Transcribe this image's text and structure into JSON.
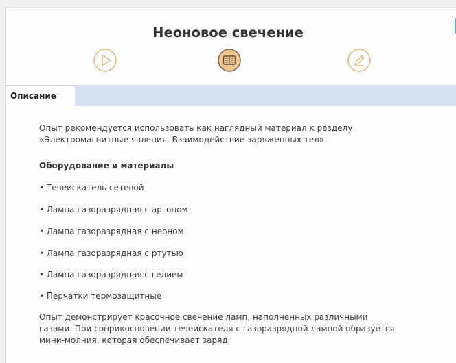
{
  "page": {
    "title": "Неоновое свечение",
    "modes": [
      {
        "icon": "play-icon"
      },
      {
        "icon": "book-icon"
      },
      {
        "icon": "pencil-icon"
      }
    ]
  },
  "tabs": [
    {
      "label": "Описание",
      "active": true
    }
  ],
  "content": {
    "intro_line1": "Опыт рекомендуется использовать как наглядный материал к разделу",
    "intro_line2": "«Электромагнитные явления. Взаимодействие заряженных тел».",
    "equipment_heading": "Оборудование и материалы",
    "equipment": [
      "• Течеискатель сетевой",
      "• Лампа газоразрядная с аргоном",
      "• Лампа газоразрядная с неоном",
      "• Лампа газоразрядная с ртутью",
      "• Лампа газоразрядная с гелием",
      "• Перчатки термозащитные"
    ],
    "outro_line1": "Опыт демонстрирует красочное свечение ламп, наполненных различными",
    "outro_line2": "газами. При соприкосновении течеискателя с газоразрядной лампой образуется",
    "outro_line3": "мини-молния, которая обеспечивает заряд."
  },
  "colors": {
    "accent": "#f0c58a",
    "accent_stroke": "#d8a45e",
    "active_mode_fill": "#f2c690",
    "tabbar": "#d8e1f0",
    "corner_button": "#6aa7d8"
  }
}
